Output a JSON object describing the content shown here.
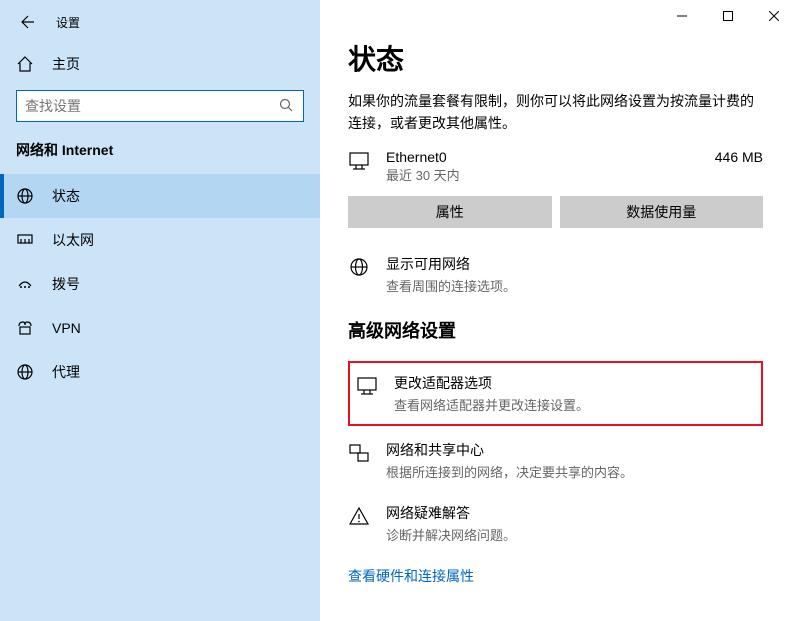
{
  "window": {
    "title": "设置"
  },
  "sidebar": {
    "home_label": "主页",
    "search_placeholder": "查找设置",
    "section_header": "网络和 Internet",
    "items": [
      {
        "label": "状态"
      },
      {
        "label": "以太网"
      },
      {
        "label": "拨号"
      },
      {
        "label": "VPN"
      },
      {
        "label": "代理"
      }
    ]
  },
  "content": {
    "heading": "状态",
    "intro": "如果你的流量套餐有限制，则你可以将此网络设置为按流量计费的连接，或者更改其他属性。",
    "connection": {
      "name": "Ethernet0",
      "sub": "最近 30 天内",
      "usage": "446 MB"
    },
    "properties_btn": "属性",
    "data_usage_btn": "数据使用量",
    "show_networks": {
      "title": "显示可用网络",
      "sub": "查看周围的连接选项。"
    },
    "adv_heading": "高级网络设置",
    "adapter": {
      "title": "更改适配器选项",
      "sub": "查看网络适配器并更改连接设置。"
    },
    "sharing": {
      "title": "网络和共享中心",
      "sub": "根据所连接到的网络，决定要共享的内容。"
    },
    "troubleshoot": {
      "title": "网络疑难解答",
      "sub": "诊断并解决网络问题。"
    },
    "hw_link": "查看硬件和连接属性"
  }
}
